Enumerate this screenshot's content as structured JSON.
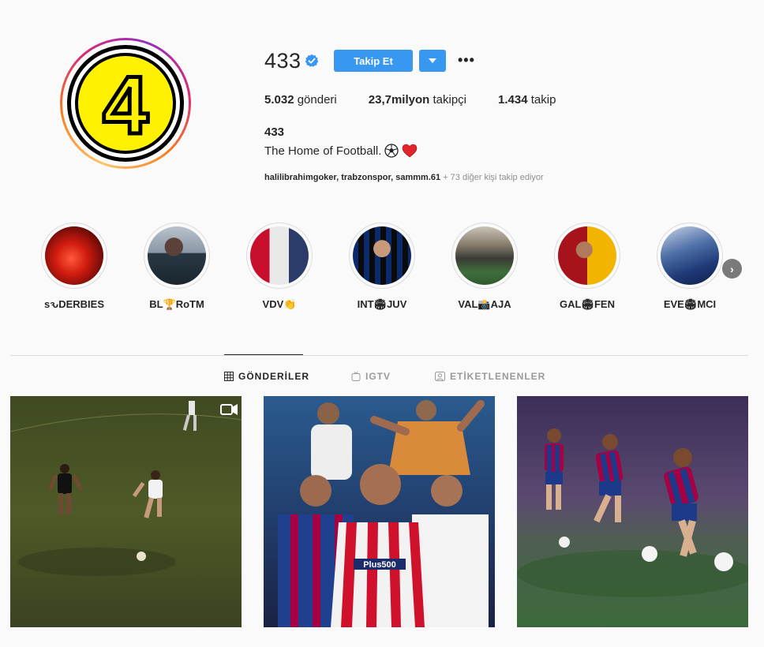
{
  "profile": {
    "username": "433",
    "verified": true,
    "follow_label": "Takip Et",
    "more_label": "•••",
    "avatar_text": "4",
    "stats": {
      "posts_count": "5.032",
      "posts_label": "gönderi",
      "followers_count": "23,7milyon",
      "followers_label": "takipçi",
      "following_count": "1.434",
      "following_label": "takip"
    },
    "full_name": "433",
    "bio_text": "The Home of Football.",
    "bio_emojis": [
      "soccer-ball-icon",
      "heart-icon"
    ],
    "followed_by_names": "halilibrahimgoker, trabzonspor, sammm.61",
    "followed_by_more": "+ 73 diğer kişi takip ediyor"
  },
  "highlights": [
    {
      "label": "ѕԅDERBIES"
    },
    {
      "label": "BL🏆RoTM"
    },
    {
      "label": "VDV👏"
    },
    {
      "label": "INT🏟JUV"
    },
    {
      "label": "VAL📸AJA"
    },
    {
      "label": "GAL🏟FEN"
    },
    {
      "label": "EVE🏟MCI"
    }
  ],
  "tabs": [
    {
      "label": "GÖNDERİLER",
      "active": true,
      "icon": "grid-icon"
    },
    {
      "label": "IGTV",
      "active": false,
      "icon": "igtv-icon"
    },
    {
      "label": "ETİKETLENENLER",
      "active": false,
      "icon": "tagged-icon"
    }
  ],
  "colors": {
    "accent": "#3897f0",
    "verified": "#3897f0",
    "text": "#262626",
    "muted": "#8e8e8e"
  }
}
